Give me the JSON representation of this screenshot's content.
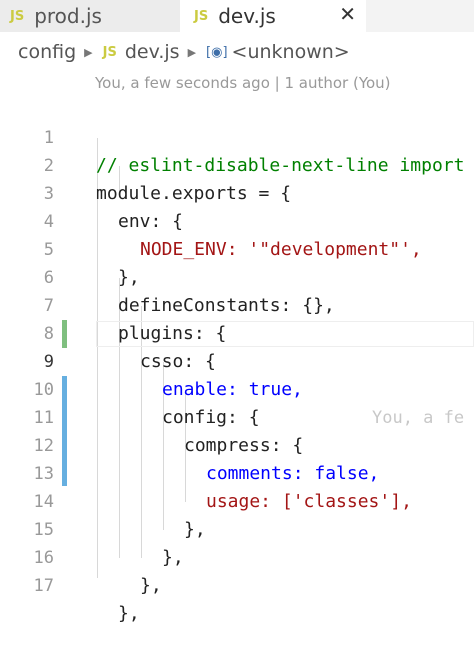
{
  "tabs": [
    {
      "badge": "JS",
      "label": "prod.js"
    },
    {
      "badge": "JS",
      "label": "dev.js",
      "close": "✕"
    }
  ],
  "breadcrumb": {
    "folder": "config",
    "file_badge": "JS",
    "file": "dev.js",
    "symbol_icon": "[◉]",
    "symbol": "<unknown>",
    "separator": "▶"
  },
  "codelens": "You, a few seconds ago | 1 author (You)",
  "ghost_blame": "You, a fe",
  "lines": [
    {
      "n": "1",
      "text": "// eslint-disable-next-line import"
    },
    {
      "n": "2",
      "text": "module.exports = {"
    },
    {
      "n": "3",
      "text": "env: {"
    },
    {
      "n": "4",
      "text": "NODE_ENV: '\"development\"',"
    },
    {
      "n": "5",
      "text": "},"
    },
    {
      "n": "6",
      "text": "defineConstants: {},"
    },
    {
      "n": "7",
      "text": "plugins: {"
    },
    {
      "n": "8",
      "text": "csso: {"
    },
    {
      "n": "9",
      "text": "enable: true,"
    },
    {
      "n": "10",
      "text": "config: {"
    },
    {
      "n": "11",
      "text": "compress: {"
    },
    {
      "n": "12",
      "text": "comments: false,"
    },
    {
      "n": "13",
      "text": "usage: ['classes'],"
    },
    {
      "n": "14",
      "text": "},"
    },
    {
      "n": "15",
      "text": "},"
    },
    {
      "n": "16",
      "text": "},"
    },
    {
      "n": "17",
      "text": "},"
    }
  ],
  "colors": {
    "comment": "#008000",
    "keyword": "#0000ff",
    "string": "#a31515",
    "added_marker": "#7fbf7f",
    "modified_marker": "#66afe0"
  }
}
